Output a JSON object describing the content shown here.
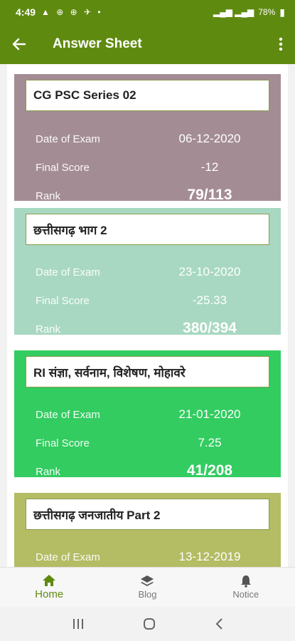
{
  "status": {
    "time": "4:49",
    "battery": "78%"
  },
  "header": {
    "title": "Answer Sheet"
  },
  "labels": {
    "date": "Date of Exam",
    "score": "Final Score",
    "rank": "Rank"
  },
  "colors": {
    "header": "#5f8a10",
    "card1": "#a48c94",
    "card2": "#a8d8c2",
    "card3": "#32cc60",
    "card4": "#b4bc64"
  },
  "cards": [
    {
      "title": "CG PSC Series 02",
      "date": "06-12-2020",
      "score": "-12",
      "rank": "79/113"
    },
    {
      "title": "छत्तीसगढ़ भाग 2",
      "date": "23-10-2020",
      "score": "-25.33",
      "rank": "380/394"
    },
    {
      "title": "RI संज्ञा, सर्वनाम, विशेषण, मोहावरे",
      "date": "21-01-2020",
      "score": "7.25",
      "rank": "41/208"
    },
    {
      "title": "छत्तीसगढ़ जनजातीय Part 2",
      "date": "13-12-2019",
      "score": "",
      "rank": ""
    }
  ],
  "nav": {
    "home": "Home",
    "blog": "Blog",
    "notice": "Notice"
  }
}
